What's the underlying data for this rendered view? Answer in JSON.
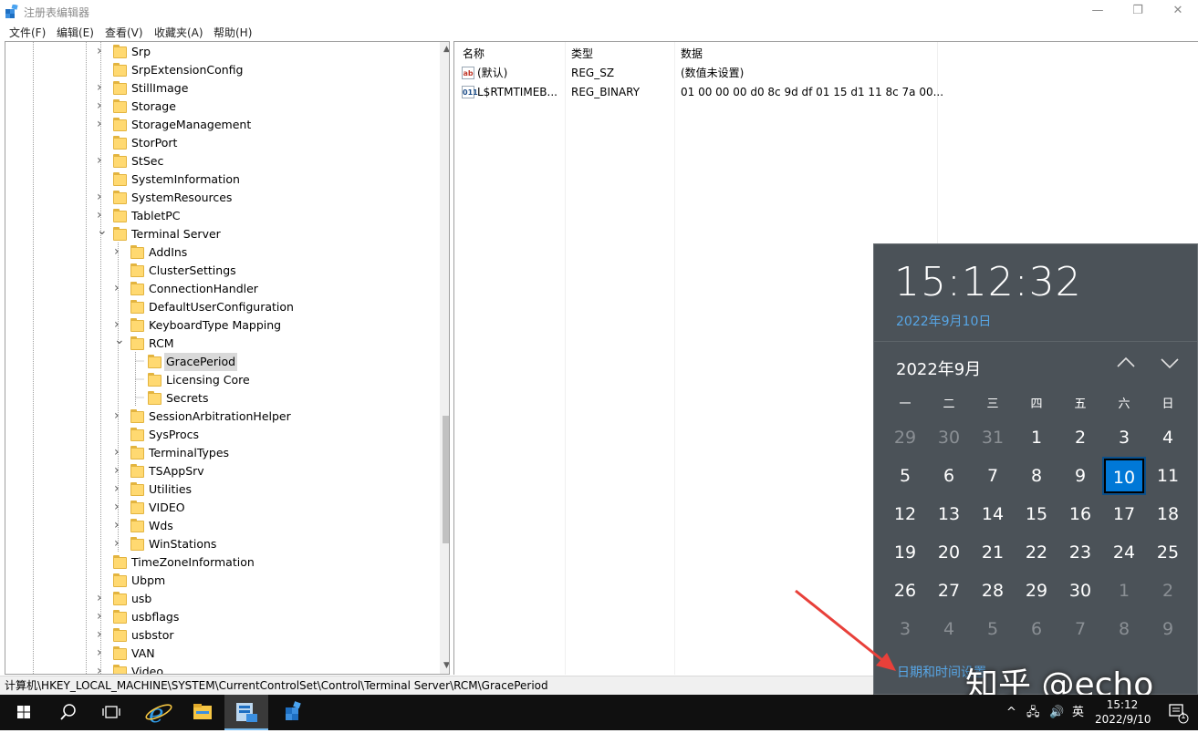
{
  "window": {
    "title": "注册表编辑器",
    "controls": {
      "minimize": "—",
      "maximize": "❐",
      "close": "✕"
    }
  },
  "menu": [
    "文件(F)",
    "编辑(E)",
    "查看(V)",
    "收藏夹(A)",
    "帮助(H)"
  ],
  "tree": [
    {
      "label": "Srp",
      "level": 0,
      "expander": "collapsed"
    },
    {
      "label": "SrpExtensionConfig",
      "level": 0,
      "expander": "none"
    },
    {
      "label": "StillImage",
      "level": 0,
      "expander": "collapsed"
    },
    {
      "label": "Storage",
      "level": 0,
      "expander": "collapsed"
    },
    {
      "label": "StorageManagement",
      "level": 0,
      "expander": "collapsed"
    },
    {
      "label": "StorPort",
      "level": 0,
      "expander": "none"
    },
    {
      "label": "StSec",
      "level": 0,
      "expander": "collapsed"
    },
    {
      "label": "SystemInformation",
      "level": 0,
      "expander": "none"
    },
    {
      "label": "SystemResources",
      "level": 0,
      "expander": "collapsed"
    },
    {
      "label": "TabletPC",
      "level": 0,
      "expander": "collapsed"
    },
    {
      "label": "Terminal Server",
      "level": 0,
      "expander": "expanded"
    },
    {
      "label": "AddIns",
      "level": 1,
      "expander": "collapsed"
    },
    {
      "label": "ClusterSettings",
      "level": 1,
      "expander": "none"
    },
    {
      "label": "ConnectionHandler",
      "level": 1,
      "expander": "collapsed"
    },
    {
      "label": "DefaultUserConfiguration",
      "level": 1,
      "expander": "none"
    },
    {
      "label": "KeyboardType Mapping",
      "level": 1,
      "expander": "collapsed"
    },
    {
      "label": "RCM",
      "level": 1,
      "expander": "expanded"
    },
    {
      "label": "GracePeriod",
      "level": 2,
      "expander": "none",
      "selected": true
    },
    {
      "label": "Licensing Core",
      "level": 2,
      "expander": "none"
    },
    {
      "label": "Secrets",
      "level": 2,
      "expander": "none"
    },
    {
      "label": "SessionArbitrationHelper",
      "level": 1,
      "expander": "collapsed"
    },
    {
      "label": "SysProcs",
      "level": 1,
      "expander": "none"
    },
    {
      "label": "TerminalTypes",
      "level": 1,
      "expander": "collapsed"
    },
    {
      "label": "TSAppSrv",
      "level": 1,
      "expander": "collapsed"
    },
    {
      "label": "Utilities",
      "level": 1,
      "expander": "collapsed"
    },
    {
      "label": "VIDEO",
      "level": 1,
      "expander": "collapsed"
    },
    {
      "label": "Wds",
      "level": 1,
      "expander": "collapsed"
    },
    {
      "label": "WinStations",
      "level": 1,
      "expander": "collapsed"
    },
    {
      "label": "TimeZoneInformation",
      "level": 0,
      "expander": "none"
    },
    {
      "label": "Ubpm",
      "level": 0,
      "expander": "none"
    },
    {
      "label": "usb",
      "level": 0,
      "expander": "collapsed"
    },
    {
      "label": "usbflags",
      "level": 0,
      "expander": "collapsed"
    },
    {
      "label": "usbstor",
      "level": 0,
      "expander": "collapsed"
    },
    {
      "label": "VAN",
      "level": 0,
      "expander": "collapsed"
    },
    {
      "label": "Video",
      "level": 0,
      "expander": "collapsed"
    }
  ],
  "list": {
    "columns": [
      "名称",
      "类型",
      "数据"
    ],
    "rows": [
      {
        "name": "(默认)",
        "type": "REG_SZ",
        "data": "(数值未设置)",
        "icon": "string-value-icon",
        "icon_text": "ab"
      },
      {
        "name": "L$RTMTIMEB...",
        "type": "REG_BINARY",
        "data": "01 00 00 00 d0 8c 9d df 01 15 d1 11 8c 7a 00...",
        "icon": "binary-value-icon",
        "icon_text": "011"
      }
    ]
  },
  "status": {
    "path": "计算机\\HKEY_LOCAL_MACHINE\\SYSTEM\\CurrentControlSet\\Control\\Terminal Server\\RCM\\GracePeriod"
  },
  "calendar": {
    "clock": "15:12:32",
    "long_date": "2022年9月10日",
    "month_label": "2022年9月",
    "weekdays": [
      "一",
      "二",
      "三",
      "四",
      "五",
      "六",
      "日"
    ],
    "weeks": [
      [
        {
          "d": "29",
          "o": true
        },
        {
          "d": "30",
          "o": true
        },
        {
          "d": "31",
          "o": true
        },
        {
          "d": "1"
        },
        {
          "d": "2"
        },
        {
          "d": "3"
        },
        {
          "d": "4"
        }
      ],
      [
        {
          "d": "5"
        },
        {
          "d": "6"
        },
        {
          "d": "7"
        },
        {
          "d": "8"
        },
        {
          "d": "9"
        },
        {
          "d": "10",
          "today": true
        },
        {
          "d": "11"
        }
      ],
      [
        {
          "d": "12"
        },
        {
          "d": "13"
        },
        {
          "d": "14"
        },
        {
          "d": "15"
        },
        {
          "d": "16"
        },
        {
          "d": "17"
        },
        {
          "d": "18"
        }
      ],
      [
        {
          "d": "19"
        },
        {
          "d": "20"
        },
        {
          "d": "21"
        },
        {
          "d": "22"
        },
        {
          "d": "23"
        },
        {
          "d": "24"
        },
        {
          "d": "25"
        }
      ],
      [
        {
          "d": "26"
        },
        {
          "d": "27"
        },
        {
          "d": "28"
        },
        {
          "d": "29"
        },
        {
          "d": "30"
        },
        {
          "d": "1",
          "o": true
        },
        {
          "d": "2",
          "o": true
        }
      ],
      [
        {
          "d": "3",
          "o": true
        },
        {
          "d": "4",
          "o": true
        },
        {
          "d": "5",
          "o": true
        },
        {
          "d": "6",
          "o": true
        },
        {
          "d": "7",
          "o": true
        },
        {
          "d": "8",
          "o": true
        },
        {
          "d": "9",
          "o": true
        }
      ]
    ],
    "settings_link": "日期和时间设置"
  },
  "taskbar": {
    "time": "15:12",
    "date": "2022/9/10",
    "ime": "英",
    "notification_count": "1"
  },
  "watermark": "知乎 @echo",
  "colors": {
    "calendar_bg": "#4b5258",
    "accent_link": "#57a6e6",
    "today_highlight": "#0078d7",
    "folder": "#ffd971",
    "annotation_arrow": "#e8403a"
  }
}
